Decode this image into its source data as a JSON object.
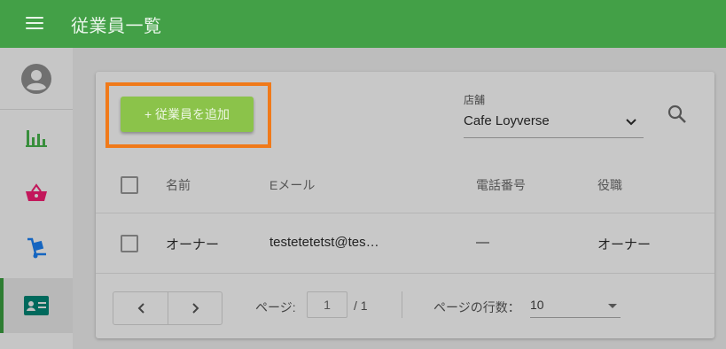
{
  "app": {
    "title": "従業員一覧"
  },
  "toolbar": {
    "add_employee_label": "+ 従業員を追加"
  },
  "store_filter": {
    "label": "店舗",
    "value": "Cafe Loyverse"
  },
  "table": {
    "headers": {
      "name": "名前",
      "email": "Eメール",
      "phone": "電話番号",
      "role": "役職"
    },
    "rows": [
      {
        "name": "オーナー",
        "email": "testetetetst@tes…",
        "phone": "—",
        "role": "オーナー"
      }
    ]
  },
  "pagination": {
    "page_label": "ページ:",
    "current_page": "1",
    "total_pages": "/ 1",
    "rows_per_page_label": "ページの行数：",
    "rows_per_page": "10"
  },
  "colors": {
    "appbar": "#43a047",
    "accent_button": "#8bc34a",
    "highlight": "#f07a1a"
  }
}
